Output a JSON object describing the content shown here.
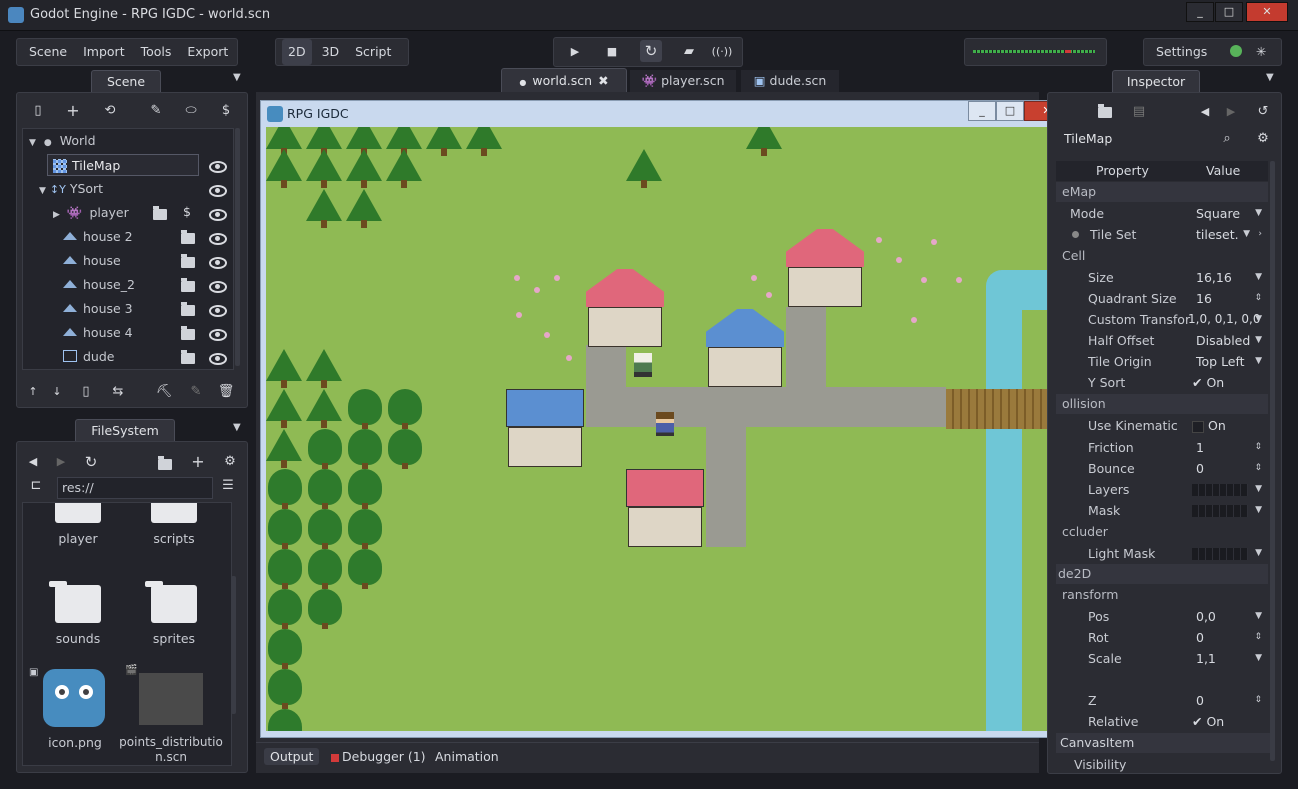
{
  "window": {
    "title": "Godot Engine - RPG IGDC - world.scn",
    "controls": [
      "_",
      "□",
      "✕"
    ]
  },
  "menu": [
    "Scene",
    "Import",
    "Tools",
    "Export"
  ],
  "modes": [
    "2D",
    "3D",
    "Script"
  ],
  "active_mode": "2D",
  "settings_label": "Settings",
  "scene_dock": {
    "tab": "Scene",
    "tree": [
      {
        "label": "World"
      },
      {
        "label": "TileMap"
      },
      {
        "label": "YSort"
      },
      {
        "label": "player"
      },
      {
        "label": "house 2"
      },
      {
        "label": "house"
      },
      {
        "label": "house_2"
      },
      {
        "label": "house 3"
      },
      {
        "label": "house 4"
      },
      {
        "label": "dude"
      }
    ]
  },
  "filesystem": {
    "tab": "FileSystem",
    "path": "res://",
    "items": [
      {
        "label": "player"
      },
      {
        "label": "scripts"
      },
      {
        "label": "sounds"
      },
      {
        "label": "sprites"
      },
      {
        "label": "icon.png"
      },
      {
        "label": "points_distribution.scn"
      }
    ]
  },
  "editor_tabs": [
    {
      "label": "world.scn",
      "active": true
    },
    {
      "label": "player.scn",
      "active": false
    },
    {
      "label": "dude.scn",
      "active": false
    }
  ],
  "game_window": {
    "title": "RPG IGDC"
  },
  "bottom_tabs": [
    "Output",
    "Debugger (1)",
    "Animation"
  ],
  "inspector": {
    "tab": "Inspector",
    "node": "TileMap",
    "col_property": "Property",
    "col_value": "Value",
    "rows": [
      {
        "type": "section",
        "label": "eMap"
      },
      {
        "type": "prop",
        "key": "Mode",
        "value": "Square"
      },
      {
        "type": "prop",
        "key": "Tile Set",
        "value": "tileset."
      },
      {
        "type": "section",
        "label": "Cell"
      },
      {
        "type": "prop",
        "key": "Size",
        "value": "16,16"
      },
      {
        "type": "prop",
        "key": "Quadrant Size",
        "value": "16"
      },
      {
        "type": "prop",
        "key": "Custom Transfor",
        "value": "1,0, 0,1, 0,0"
      },
      {
        "type": "prop",
        "key": "Half Offset",
        "value": "Disabled"
      },
      {
        "type": "prop",
        "key": "Tile Origin",
        "value": "Top Left"
      },
      {
        "type": "prop",
        "key": "Y Sort",
        "value": "On"
      },
      {
        "type": "section",
        "label": "ollision"
      },
      {
        "type": "prop",
        "key": "Use Kinematic",
        "value": "On"
      },
      {
        "type": "prop",
        "key": "Friction",
        "value": "1"
      },
      {
        "type": "prop",
        "key": "Bounce",
        "value": "0"
      },
      {
        "type": "prop",
        "key": "Layers",
        "value": ""
      },
      {
        "type": "prop",
        "key": "Mask",
        "value": ""
      },
      {
        "type": "section",
        "label": "ccluder"
      },
      {
        "type": "prop",
        "key": "Light Mask",
        "value": ""
      },
      {
        "type": "section",
        "label": "de2D"
      },
      {
        "type": "section",
        "label": "ransform"
      },
      {
        "type": "prop",
        "key": "Pos",
        "value": "0,0"
      },
      {
        "type": "prop",
        "key": "Rot",
        "value": "0"
      },
      {
        "type": "prop",
        "key": "Scale",
        "value": "1,1"
      },
      {
        "type": "section",
        "label": ""
      },
      {
        "type": "prop",
        "key": "Z",
        "value": "0"
      },
      {
        "type": "prop",
        "key": "Relative",
        "value": "On"
      },
      {
        "type": "section",
        "label": "CanvasItem"
      },
      {
        "type": "prop",
        "key": "Visibility",
        "value": ""
      }
    ]
  },
  "colors": {
    "background": "#1b1c22",
    "panel": "#2b2c33",
    "grass": "#8fba54",
    "tree": "#2f7a2a",
    "water": "#6fc6d6",
    "roof_red": "#e0677b",
    "roof_blue": "#5b8fd1"
  }
}
